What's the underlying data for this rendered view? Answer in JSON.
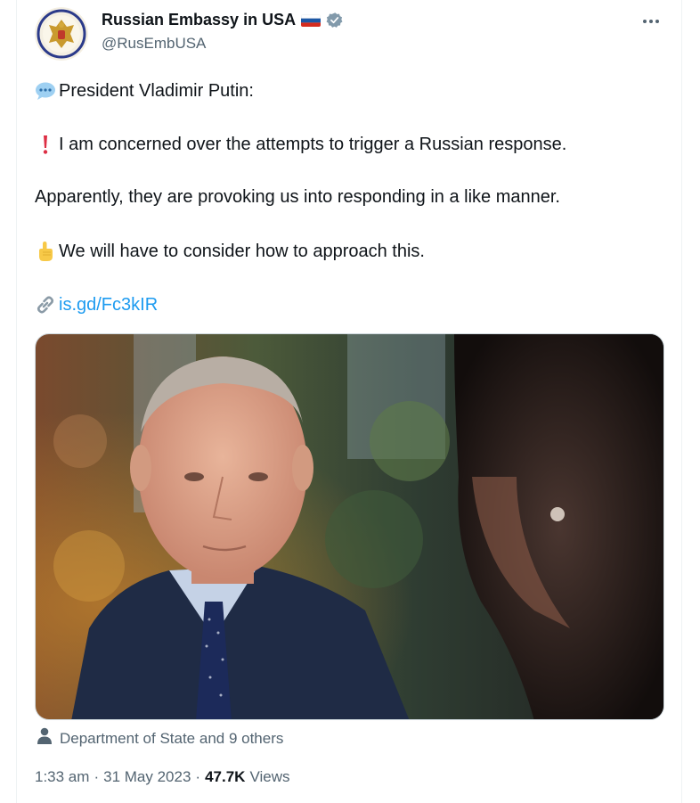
{
  "tweet": {
    "display_name": "Russian Embassy in USA",
    "handle": "@RusEmbUSA",
    "flag_icon": "russia-flag-icon",
    "verified_icon": "verified-badge-icon",
    "more_icon": "more-options-icon",
    "lines": [
      {
        "emoji": "speech-bubble-icon",
        "text": "President Vladimir Putin:"
      },
      {
        "emoji": "exclamation-icon",
        "text": "I am concerned over the attempts to trigger a Russian response."
      },
      {
        "emoji": "",
        "text": "Apparently, they are provoking us into responding in a like manner."
      },
      {
        "emoji": "pointing-up-icon",
        "text": "We will have to consider how to approach this."
      }
    ],
    "link": {
      "icon": "link-icon",
      "text": "is.gd/Fc3kIR"
    },
    "tagged": {
      "icon": "person-icon",
      "text": "Department of State and 9 others"
    },
    "meta": {
      "time": "1:33 am",
      "separator": "·",
      "date": "31 May 2023",
      "views_count": "47.7K",
      "views_label": "Views"
    },
    "colors": {
      "link": "#1d9bf0",
      "secondary_text": "#536471",
      "primary_text": "#0f1419",
      "verified": "#829aab"
    }
  }
}
